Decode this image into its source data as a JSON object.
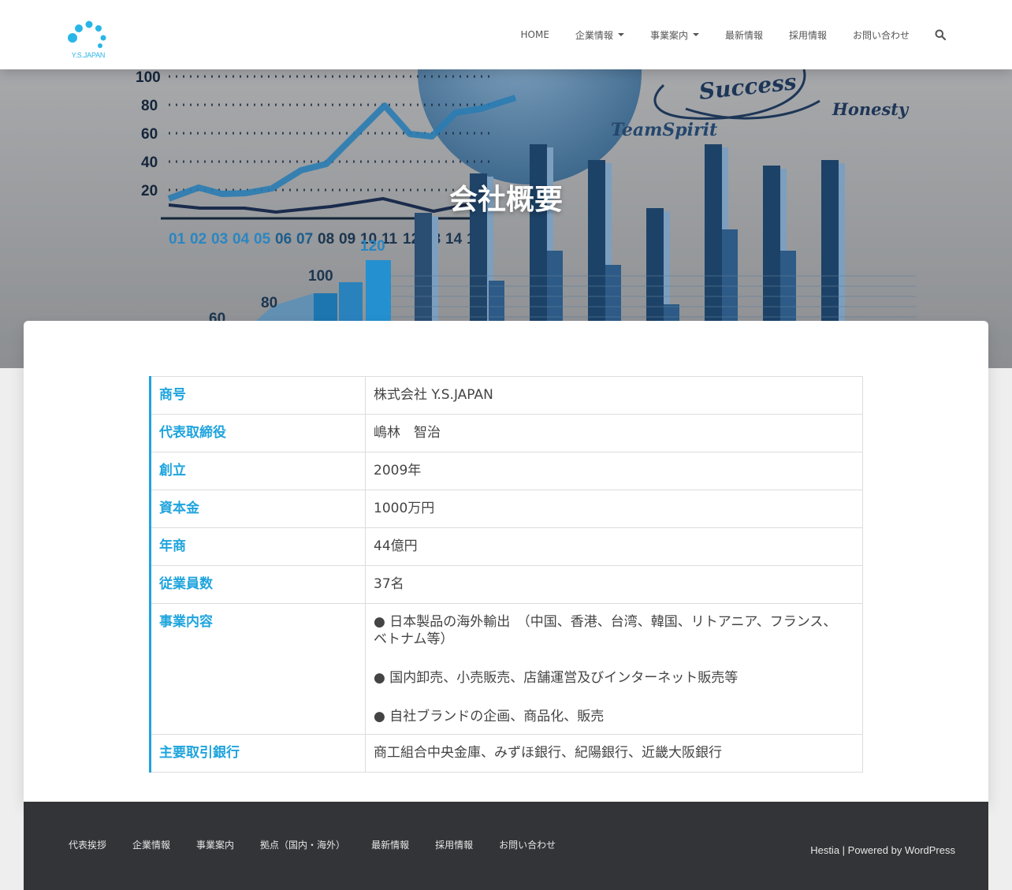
{
  "header": {
    "logo_text": "Y.S.JAPAN",
    "nav": [
      {
        "label": "HOME",
        "dropdown": false
      },
      {
        "label": "企業情報",
        "dropdown": true
      },
      {
        "label": "事業案内",
        "dropdown": true
      },
      {
        "label": "最新情報",
        "dropdown": false
      },
      {
        "label": "採用情報",
        "dropdown": false
      },
      {
        "label": "お問い合わせ",
        "dropdown": false
      }
    ],
    "search_icon": "search-icon",
    "accent": "#29b5e8"
  },
  "hero": {
    "title": "会社概要",
    "image_text": {
      "y_ticks": [
        "100",
        "80",
        "60",
        "40",
        "20"
      ],
      "x_ticks": [
        "01",
        "02",
        "03",
        "04",
        "05",
        "06",
        "07",
        "08",
        "09",
        "10",
        "11",
        "12",
        "13",
        "14",
        "15"
      ],
      "bar_labels": [
        "120",
        "100",
        "80",
        "60"
      ],
      "words": [
        "Success",
        "Honesty",
        "TeamSpirit"
      ]
    }
  },
  "company": {
    "rows": [
      {
        "key": "商号",
        "value": "株式会社 Y.S.JAPAN"
      },
      {
        "key": "代表取締役",
        "value": "嶋林　智治"
      },
      {
        "key": "創立",
        "value": "2009年"
      },
      {
        "key": "資本金",
        "value": "1000万円"
      },
      {
        "key": "年商",
        "value": "44億円"
      },
      {
        "key": "従業員数",
        "value": "37名"
      }
    ],
    "business": {
      "key": "事業内容",
      "lines": [
        "● 日本製品の海外輸出　（中国、香港、台湾、韓国、リトアニア、フランス、ベトナム等）",
        "● 国内卸売、小売販売、店舗運営及びインターネット販売等",
        "● 自社ブランドの企画、商品化、販売"
      ]
    },
    "bank": {
      "key": "主要取引銀行",
      "value": "商工組合中央金庫、みずほ銀行、紀陽銀行、近畿大阪銀行"
    },
    "key_color": "#1fa4dd"
  },
  "footer": {
    "nav": [
      "代表挨拶",
      "企業情報",
      "事業案内",
      "拠点（国内・海外）",
      "最新情報",
      "採用情報",
      "お問い合わせ"
    ],
    "credit_theme": "Hestia",
    "credit_sep": " | Powered by ",
    "credit_platform": "WordPress"
  }
}
